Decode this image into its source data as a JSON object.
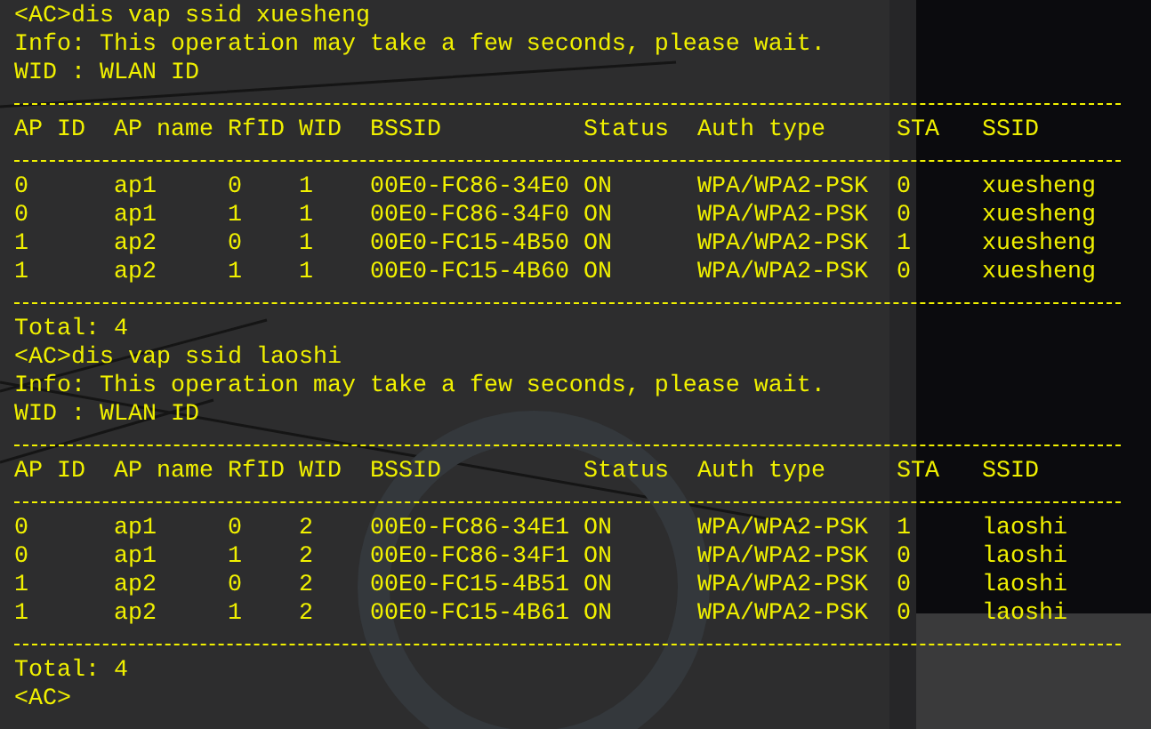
{
  "terminal": {
    "blocks": [
      {
        "command": "<AC>dis vap ssid xuesheng",
        "info": "Info: This operation may take a few seconds, please wait.",
        "legend": "WID : WLAN ID",
        "columns": [
          "AP ID",
          "AP name",
          "RfID",
          "WID",
          "BSSID",
          "Status",
          "Auth type",
          "STA",
          "SSID"
        ],
        "rows": [
          [
            "0",
            "ap1",
            "0",
            "1",
            "00E0-FC86-34E0",
            "ON",
            "WPA/WPA2-PSK",
            "0",
            "xuesheng"
          ],
          [
            "0",
            "ap1",
            "1",
            "1",
            "00E0-FC86-34F0",
            "ON",
            "WPA/WPA2-PSK",
            "0",
            "xuesheng"
          ],
          [
            "1",
            "ap2",
            "0",
            "1",
            "00E0-FC15-4B50",
            "ON",
            "WPA/WPA2-PSK",
            "1",
            "xuesheng"
          ],
          [
            "1",
            "ap2",
            "1",
            "1",
            "00E0-FC15-4B60",
            "ON",
            "WPA/WPA2-PSK",
            "0",
            "xuesheng"
          ]
        ],
        "total": "Total: 4"
      },
      {
        "command": "<AC>dis vap ssid laoshi",
        "info": "Info: This operation may take a few seconds, please wait.",
        "legend": "WID : WLAN ID",
        "columns": [
          "AP ID",
          "AP name",
          "RfID",
          "WID",
          "BSSID",
          "Status",
          "Auth type",
          "STA",
          "SSID"
        ],
        "rows": [
          [
            "0",
            "ap1",
            "0",
            "2",
            "00E0-FC86-34E1",
            "ON",
            "WPA/WPA2-PSK",
            "1",
            "laoshi"
          ],
          [
            "0",
            "ap1",
            "1",
            "2",
            "00E0-FC86-34F1",
            "ON",
            "WPA/WPA2-PSK",
            "0",
            "laoshi"
          ],
          [
            "1",
            "ap2",
            "0",
            "2",
            "00E0-FC15-4B51",
            "ON",
            "WPA/WPA2-PSK",
            "0",
            "laoshi"
          ],
          [
            "1",
            "ap2",
            "1",
            "2",
            "00E0-FC15-4B61",
            "ON",
            "WPA/WPA2-PSK",
            "0",
            "laoshi"
          ]
        ],
        "total": "Total: 4"
      }
    ],
    "prompt": "<AC>"
  }
}
